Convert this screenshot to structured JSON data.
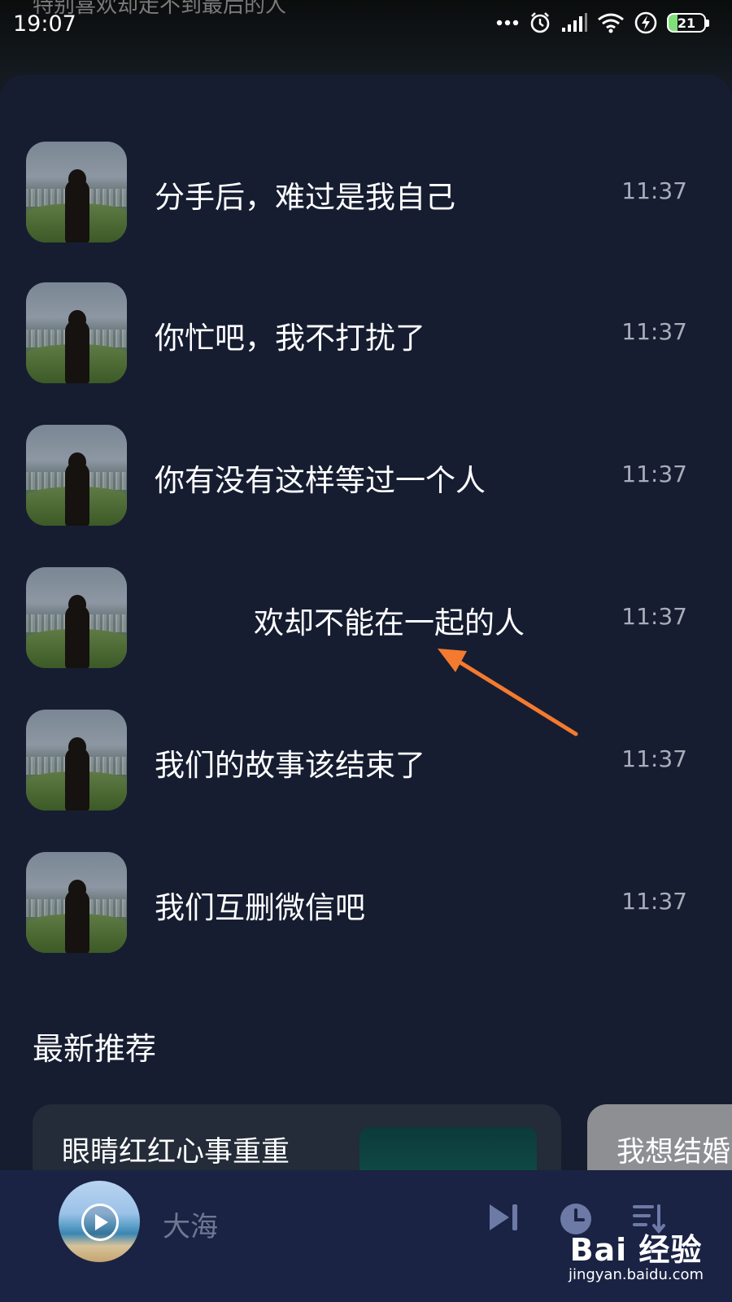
{
  "status_bar": {
    "time": "19:07",
    "background_lyric": "特别喜欢却走不到最后的人",
    "battery_level": "21"
  },
  "songs": [
    {
      "title": "分手后，难过是我自己",
      "time": "11:37"
    },
    {
      "title": "你忙吧，我不打扰了",
      "time": "11:37"
    },
    {
      "title": "你有没有这样等过一个人",
      "time": "11:37"
    },
    {
      "title": "欢却不能在一起的人",
      "time": "11:37"
    },
    {
      "title": "我们的故事该结束了",
      "time": "11:37"
    },
    {
      "title": "我们互删微信吧",
      "time": "11:37"
    }
  ],
  "recommend": {
    "title": "最新推荐",
    "cards": [
      {
        "title": "眼睛红红心事重重"
      },
      {
        "title": "我想结婚"
      }
    ]
  },
  "player": {
    "now_playing": "大海"
  },
  "watermark": {
    "logo": "Bai 经验",
    "url": "jingyan.baidu.com"
  },
  "colors": {
    "panel_bg": "#161d31",
    "player_bg": "#1a2344",
    "annotation_arrow": "#f47a2f",
    "time_text": "#a7adb9"
  }
}
